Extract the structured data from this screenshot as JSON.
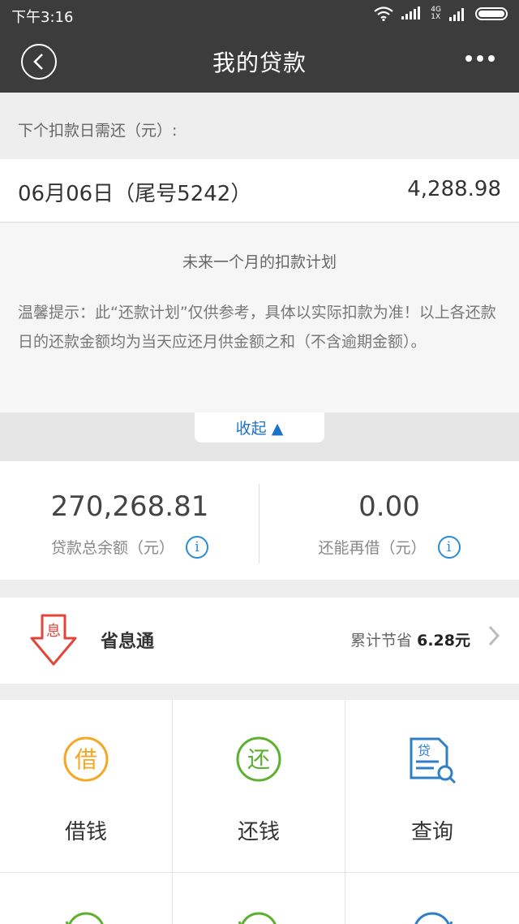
{
  "status_bar": {
    "time": "下午3:16",
    "network": "4G",
    "sim": "1X"
  },
  "header": {
    "title": "我的贷款"
  },
  "next_payment": {
    "label": "下个扣款日需还（元）:",
    "date": "06月06日（尾号5242）",
    "amount": "4,288.98"
  },
  "plan": {
    "title": "未来一个月的扣款计划",
    "tip": "温馨提示：此“还款计划”仅供参考，具体以实际扣款为准！以上各还款日的还款金额均为当天应还月供金额之和（不含逾期金额）。",
    "collapse_label": "收起 ▲"
  },
  "balance": {
    "total_value": "270,268.81",
    "total_label": "贷款总余额（元）",
    "reborrow_value": "0.00",
    "reborrow_label": "还能再借（元）"
  },
  "saver": {
    "icon_char": "息",
    "name": "省息通",
    "save_prefix": "累计节省",
    "save_amount": "6.28元"
  },
  "actions": [
    {
      "label": "借钱",
      "icon_char": "借",
      "color": "#f5a623"
    },
    {
      "label": "还钱",
      "icon_char": "还",
      "color": "#5bb12f"
    },
    {
      "label": "查询",
      "icon_char": "贷",
      "color": "#2f7fc8"
    }
  ],
  "colors": {
    "bar": "#3c3c3c",
    "accent": "#1a73c8",
    "danger": "#e2463a"
  }
}
